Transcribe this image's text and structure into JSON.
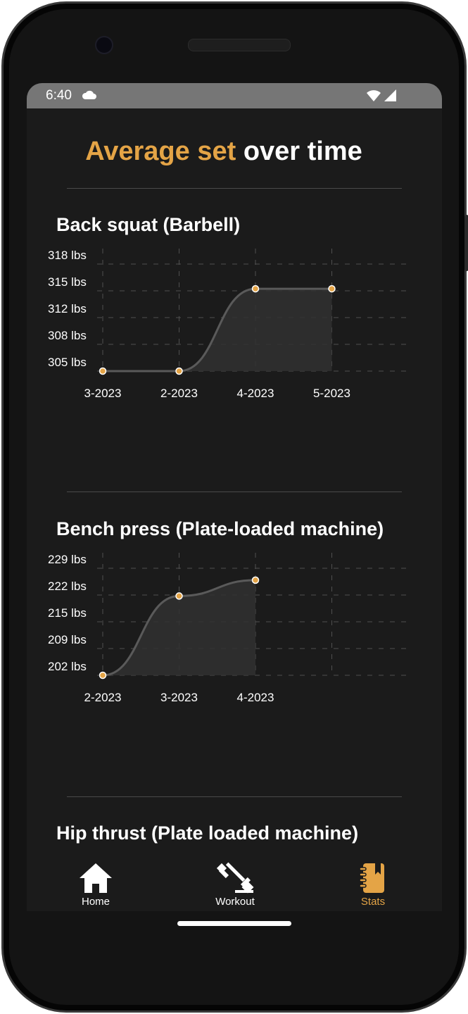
{
  "status_bar": {
    "time": "6:40",
    "icons": [
      "cloud-icon",
      "wifi-icon",
      "cellular-signal-icon"
    ]
  },
  "page": {
    "title_accent": "Average set",
    "title_rest": "over time"
  },
  "colors": {
    "accent": "#e4a446",
    "background": "#1b1b1b",
    "line": "#5a5a5a",
    "area": "#303030",
    "grid": "#4f4f4f",
    "text": "#ffffff"
  },
  "sections": [
    {
      "title": "Back squat (Barbell)"
    },
    {
      "title": "Bench press (Plate-loaded machine)"
    },
    {
      "title": "Hip thrust (Plate loaded machine)"
    }
  ],
  "chart_data": [
    {
      "type": "area",
      "title": "Back squat (Barbell)",
      "categories": [
        "3-2023",
        "2-2023",
        "4-2023",
        "5-2023"
      ],
      "values": [
        305,
        305,
        315,
        315
      ],
      "yticks": [
        "305 lbs",
        "308 lbs",
        "312 lbs",
        "315 lbs",
        "318 lbs"
      ],
      "ylim": [
        305,
        318
      ],
      "unit": "lbs",
      "grid": true,
      "curve": "smooth"
    },
    {
      "type": "area",
      "title": "Bench press (Plate-loaded machine)",
      "categories": [
        "2-2023",
        "3-2023",
        "4-2023"
      ],
      "values": [
        202,
        222,
        226
      ],
      "yticks": [
        "202 lbs",
        "209 lbs",
        "215 lbs",
        "222 lbs",
        "229 lbs"
      ],
      "ylim": [
        202,
        229
      ],
      "unit": "lbs",
      "grid": true,
      "curve": "smooth"
    }
  ],
  "nav": [
    {
      "label": "Home",
      "icon": "home-icon",
      "active": false
    },
    {
      "label": "Workout",
      "icon": "dumbbell-icon",
      "active": false
    },
    {
      "label": "Stats",
      "icon": "notebook-icon",
      "active": true
    }
  ]
}
